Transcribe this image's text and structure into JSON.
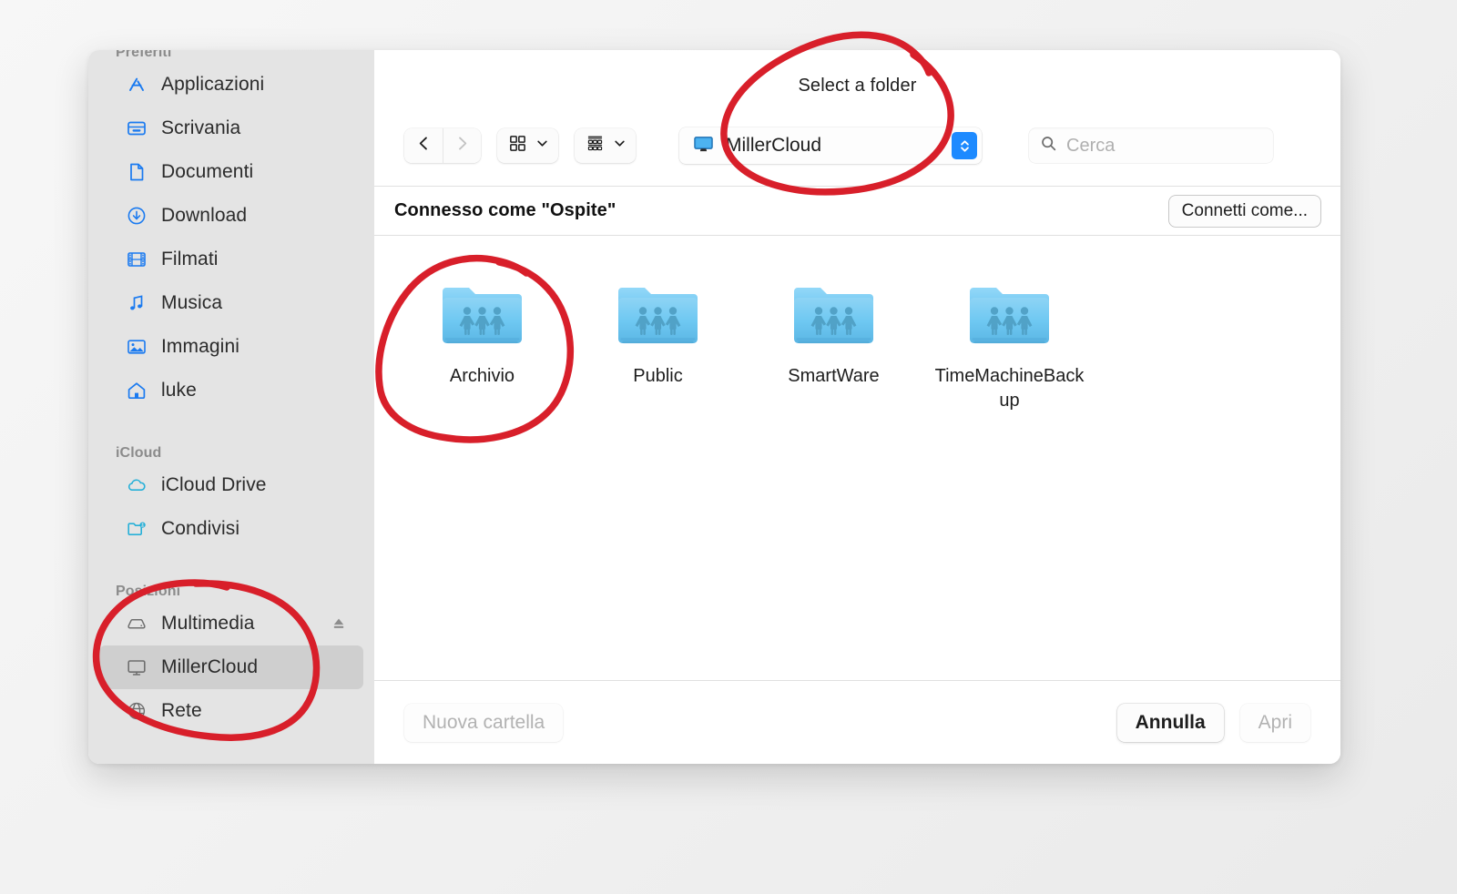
{
  "dialog": {
    "title": "Select a folder"
  },
  "sidebar": {
    "sections": [
      {
        "header": "Preferiti",
        "items": [
          {
            "label": "Applicazioni",
            "icon": "applications-icon"
          },
          {
            "label": "Scrivania",
            "icon": "desktop-icon"
          },
          {
            "label": "Documenti",
            "icon": "documents-icon"
          },
          {
            "label": "Download",
            "icon": "downloads-icon"
          },
          {
            "label": "Filmati",
            "icon": "movies-icon"
          },
          {
            "label": "Musica",
            "icon": "music-icon"
          },
          {
            "label": "Immagini",
            "icon": "pictures-icon"
          },
          {
            "label": "luke",
            "icon": "home-icon"
          }
        ]
      },
      {
        "header": "iCloud",
        "items": [
          {
            "label": "iCloud Drive",
            "icon": "cloud-icon"
          },
          {
            "label": "Condivisi",
            "icon": "shared-folder-icon"
          }
        ]
      },
      {
        "header": "Posizioni",
        "items": [
          {
            "label": "Multimedia",
            "icon": "hard-disk-icon",
            "eject": true
          },
          {
            "label": "MillerCloud",
            "icon": "display-icon",
            "selected": true
          },
          {
            "label": "Rete",
            "icon": "network-globe-icon"
          }
        ]
      }
    ]
  },
  "toolbar": {
    "back_icon": "chevron-left-icon",
    "forward_icon": "chevron-right-icon",
    "icon_view_icon": "grid-view-icon",
    "icon_view_chevron": "chevron-down-icon",
    "group_view_icon": "group-list-icon",
    "group_view_chevron": "chevron-down-icon",
    "path_label": "MillerCloud",
    "path_icon": "display-icon",
    "path_stepper_icon": "stepper-up-down-icon",
    "search_placeholder": "Cerca",
    "search_value": "",
    "search_icon": "search-icon"
  },
  "connection": {
    "status": "Connesso come \"Ospite\"",
    "connect_as_label": "Connetti come..."
  },
  "files": {
    "items": [
      {
        "name": "Archivio",
        "icon": "shared-folder-icon"
      },
      {
        "name": "Public",
        "icon": "shared-folder-icon"
      },
      {
        "name": "SmartWare",
        "icon": "shared-folder-icon"
      },
      {
        "name": "TimeMachineBackup",
        "icon": "shared-folder-icon"
      }
    ]
  },
  "footer": {
    "new_folder_label": "Nuova cartella",
    "cancel_label": "Annulla",
    "open_label": "Apri"
  },
  "colors": {
    "annotation_red": "#d81f2a",
    "accent_blue": "#1d8aff",
    "sidebar_icon_blue": "#1a7af0",
    "folder_blue": "#63c4f0",
    "selected_row": "#cfcfcf"
  },
  "annotations": {
    "circles": [
      {
        "target": "Select a folder title and path popup"
      },
      {
        "target": "Archivio folder item"
      },
      {
        "target": "Posizioni section with Multimedia and MillerCloud"
      }
    ]
  }
}
